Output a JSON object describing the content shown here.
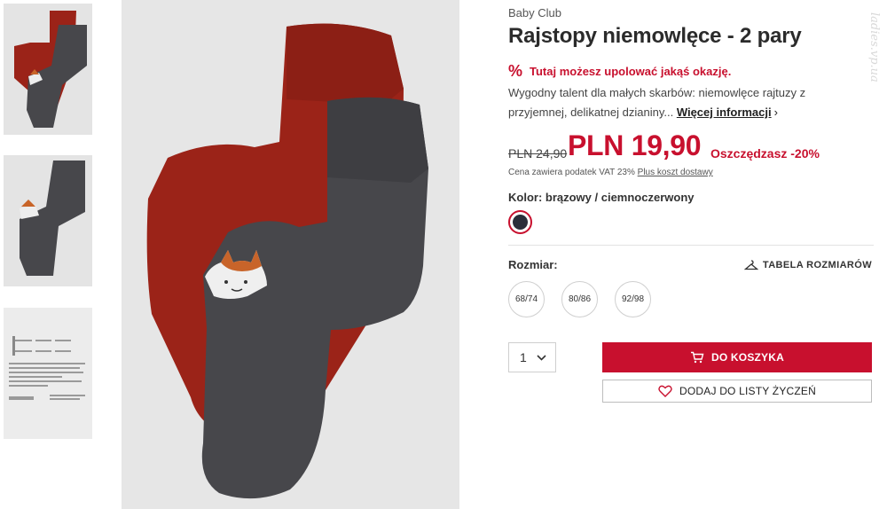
{
  "thumbnails": [
    {
      "label": "product-photo-both-pairs"
    },
    {
      "label": "product-photo-grey-pair"
    },
    {
      "label": "product-label-photo"
    }
  ],
  "product": {
    "brand": "Baby Club",
    "title": "Rajstopy niemowlęce - 2 pary",
    "promo_icon": "%",
    "promo_text": "Tutaj możesz upolować jakąś okazję.",
    "description": "Wygodny talent dla małych skarbów: niemowlęce rajtuzy z przyjemnej, delikatnej dzianiny...",
    "more_info": "Więcej informacji",
    "more_chevron": "›"
  },
  "price": {
    "old": "PLN 24,90",
    "new": "PLN 19,90",
    "savings": "Oszczędzasz -20%",
    "vat_text": "Cena zawiera podatek VAT 23%",
    "shipping_link": "Plus koszt dostawy"
  },
  "color": {
    "label": "Kolor: brązowy / ciemnoczerwony",
    "swatch_hex": "#2b2e3a"
  },
  "size": {
    "label": "Rozmiar:",
    "table_link": "TABELA ROZMIARÓW",
    "options": [
      "68/74",
      "80/86",
      "92/98"
    ]
  },
  "quantity": {
    "value": "1",
    "chevron": "⌄"
  },
  "actions": {
    "add_to_cart": "DO KOSZYKA",
    "add_to_wishlist": "DODAJ DO LISTY ŻYCZEŃ"
  },
  "watermark": "ladies.vp.ua",
  "colors": {
    "accent": "#c8102e",
    "tights_red": "#9b2318",
    "tights_grey": "#47474b"
  }
}
